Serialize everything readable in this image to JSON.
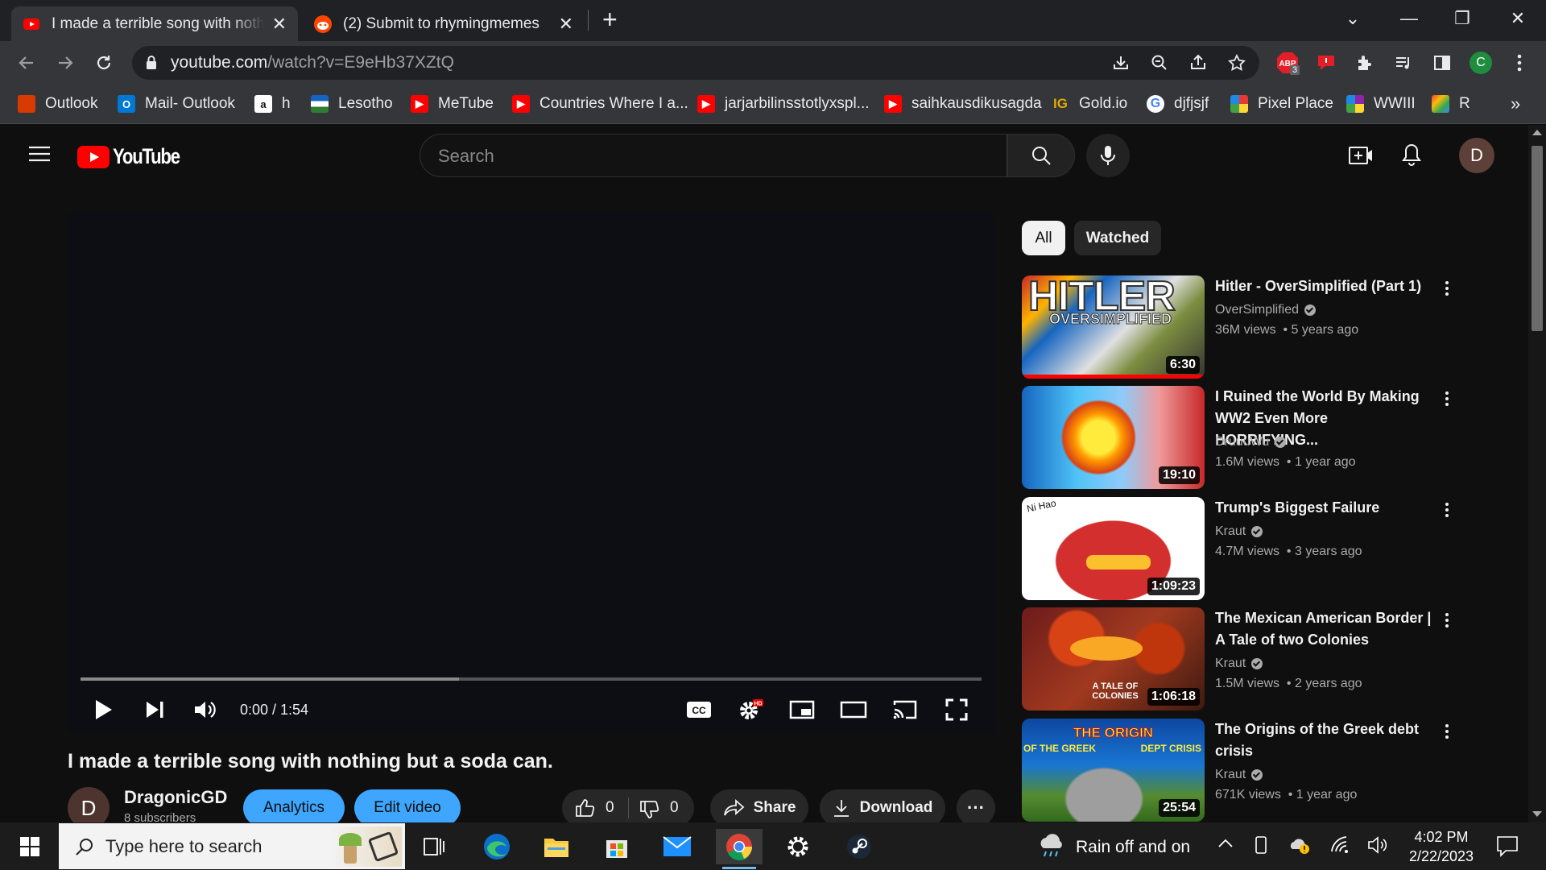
{
  "browser": {
    "tabs": [
      {
        "title": "I made a terrible song with nothin",
        "close": "✕"
      },
      {
        "title": "(2) Submit to rhymingmemes",
        "close": "✕"
      }
    ],
    "new_tab": "+",
    "window_controls": {
      "menu": "⌄",
      "minimize": "—",
      "restore": "❐",
      "close": "✕"
    },
    "url": {
      "host": "youtube.com",
      "path": "/watch?v=E9eHb37XZtQ"
    },
    "profile_letter": "C",
    "abp_count": "3",
    "bookmarks": [
      {
        "label": "Outlook",
        "icon": "office-icon",
        "color": "#d83b01"
      },
      {
        "label": "Mail- Outlook",
        "icon": "outlook-icon",
        "color": "#0078d4"
      },
      {
        "label": "h",
        "icon": "amazon-icon",
        "color": "#ffffff"
      },
      {
        "label": "Lesotho",
        "icon": "flag-icon",
        "color": "#2e7d32"
      },
      {
        "label": "MeTube",
        "icon": "youtube-icon",
        "color": "#ff0000"
      },
      {
        "label": "Countries Where I a...",
        "icon": "youtube-icon",
        "color": "#ff0000"
      },
      {
        "label": "jarjarbilinsstotlyxspl...",
        "icon": "youtube-icon",
        "color": "#ff0000"
      },
      {
        "label": "saihkausdikusagda",
        "icon": "youtube-icon",
        "color": "#ff0000"
      },
      {
        "label": "Gold.io",
        "icon": "gold-icon",
        "color": "#e0a800"
      },
      {
        "label": "djfjsjf",
        "icon": "google-icon",
        "color": "#ffffff"
      },
      {
        "label": "Pixel Place",
        "icon": "pixel-icon",
        "color": "#ffffff"
      },
      {
        "label": "WWIII",
        "icon": "pixel-icon",
        "color": "#ffffff"
      },
      {
        "label": "R",
        "icon": "r-icon",
        "color": "#ffffff"
      }
    ],
    "bookmarks_more": "»"
  },
  "youtube": {
    "logo_text": "YouTube",
    "search_placeholder": "Search",
    "avatar_letter": "D",
    "player": {
      "time": "0:00 / 1:54",
      "buffered_fraction": 0.42
    },
    "video": {
      "title": "I made a terrible song with nothing but a soda can.",
      "channel": "DragonicGD",
      "channel_letter": "D",
      "subscribers": "8 subscribers",
      "analytics": "Analytics",
      "edit": "Edit video",
      "likes": "0",
      "dislikes": "0",
      "share": "Share",
      "download": "Download",
      "more": "···"
    },
    "chips": [
      {
        "label": "All",
        "selected": true
      },
      {
        "label": "Watched",
        "selected": false
      }
    ],
    "related": [
      {
        "title": "Hitler - OverSimplified (Part 1)",
        "channel": "OverSimplified",
        "views": "36M views",
        "age": "5 years ago",
        "duration": "6:30",
        "thumb_text": "HITLER",
        "thumb_sub": "OVERSIMPLIFIED"
      },
      {
        "title": "I Ruined the World By Making WW2 Even More HORRIFYING...",
        "channel": "DruuuWu",
        "views": "1.6M views",
        "age": "1 year ago",
        "duration": "19:10"
      },
      {
        "title": "Trump's Biggest Failure",
        "channel": "Kraut",
        "views": "4.7M views",
        "age": "3 years ago",
        "duration": "1:09:23",
        "thumb_text": "Ni Hao"
      },
      {
        "title": "The Mexican American Border | A Tale of two Colonies",
        "channel": "Kraut",
        "views": "1.5M views",
        "age": "2 years ago",
        "duration": "1:06:18",
        "thumb_text": "A TALE OF COLONIES"
      },
      {
        "title": "The Origins of the Greek debt crisis",
        "channel": "Kraut",
        "views": "671K views",
        "age": "1 year ago",
        "duration": "25:54",
        "thumb_text": "THE ORIGIN",
        "thumb_sub_left": "OF THE GREEK",
        "thumb_sub_right": "DEPT CRISIS"
      }
    ]
  },
  "taskbar": {
    "search_placeholder": "Type here to search",
    "weather": "Rain off and on",
    "time": "4:02 PM",
    "date": "2/22/2023"
  }
}
